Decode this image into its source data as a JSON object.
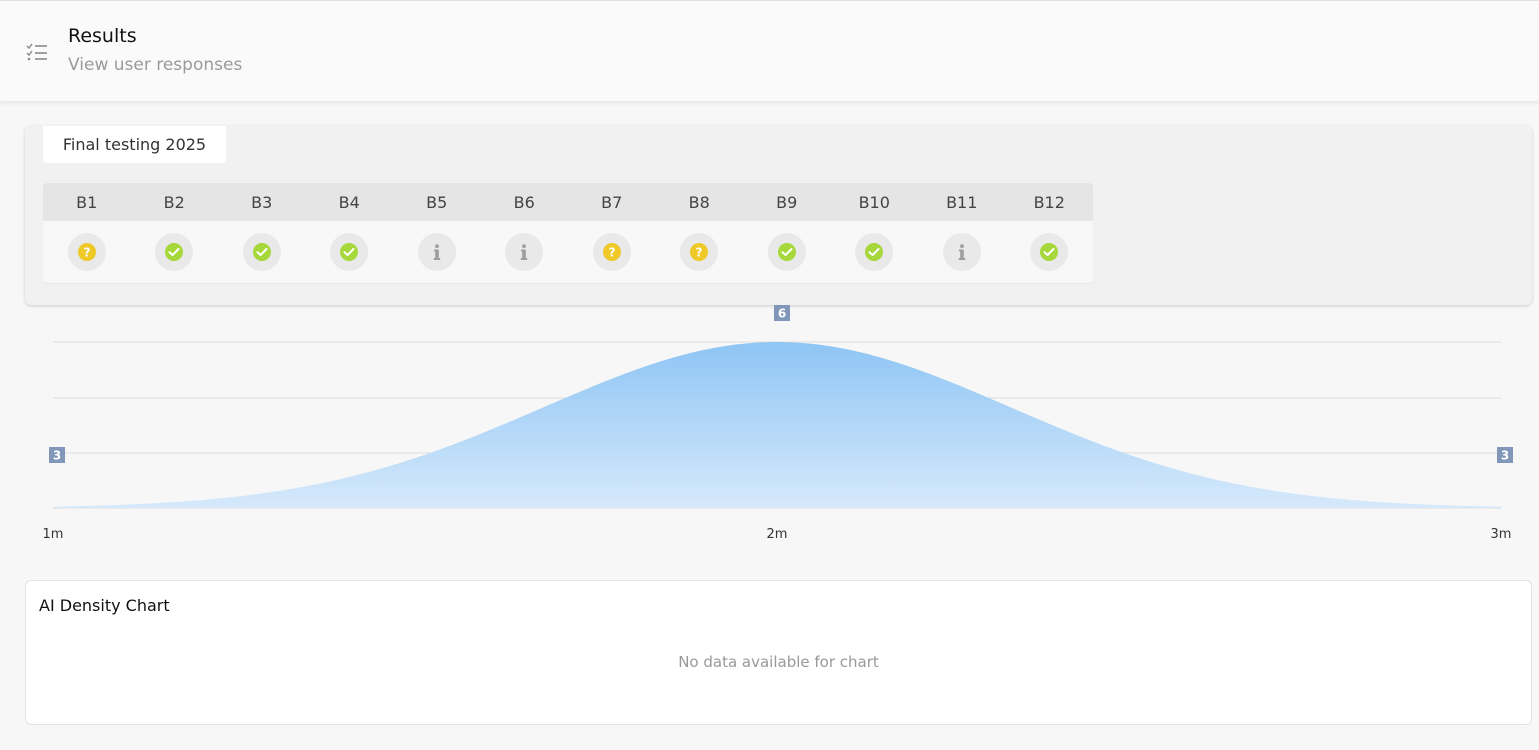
{
  "header": {
    "title": "Results",
    "subtitle": "View user responses"
  },
  "test": {
    "name": "Final testing 2025",
    "questions": [
      {
        "label": "B1",
        "status": "unanswered",
        "icon": "question-icon"
      },
      {
        "label": "B2",
        "status": "correct",
        "icon": "check-icon"
      },
      {
        "label": "B3",
        "status": "correct",
        "icon": "check-icon"
      },
      {
        "label": "B4",
        "status": "correct",
        "icon": "check-icon"
      },
      {
        "label": "B5",
        "status": "info",
        "icon": "info-icon"
      },
      {
        "label": "B6",
        "status": "info",
        "icon": "info-icon"
      },
      {
        "label": "B7",
        "status": "unanswered",
        "icon": "question-icon"
      },
      {
        "label": "B8",
        "status": "unanswered",
        "icon": "question-icon"
      },
      {
        "label": "B9",
        "status": "correct",
        "icon": "check-icon"
      },
      {
        "label": "B10",
        "status": "correct",
        "icon": "check-icon"
      },
      {
        "label": "B11",
        "status": "info",
        "icon": "info-icon"
      },
      {
        "label": "B12",
        "status": "correct",
        "icon": "check-icon"
      }
    ]
  },
  "colors": {
    "correct": "#a6d83c",
    "unanswered": "#eec927",
    "info": "#9e9e9e",
    "area": "#90c8f5",
    "label_badge": "#8197ba"
  },
  "chart_data": {
    "type": "area",
    "x": [
      "1m",
      "2m",
      "3m"
    ],
    "peak": {
      "x": "2m",
      "label": "6"
    },
    "start_label": "3",
    "end_label": "3",
    "grid": true
  },
  "ai_density": {
    "title": "AI Density Chart",
    "empty_text": "No data available for chart"
  }
}
